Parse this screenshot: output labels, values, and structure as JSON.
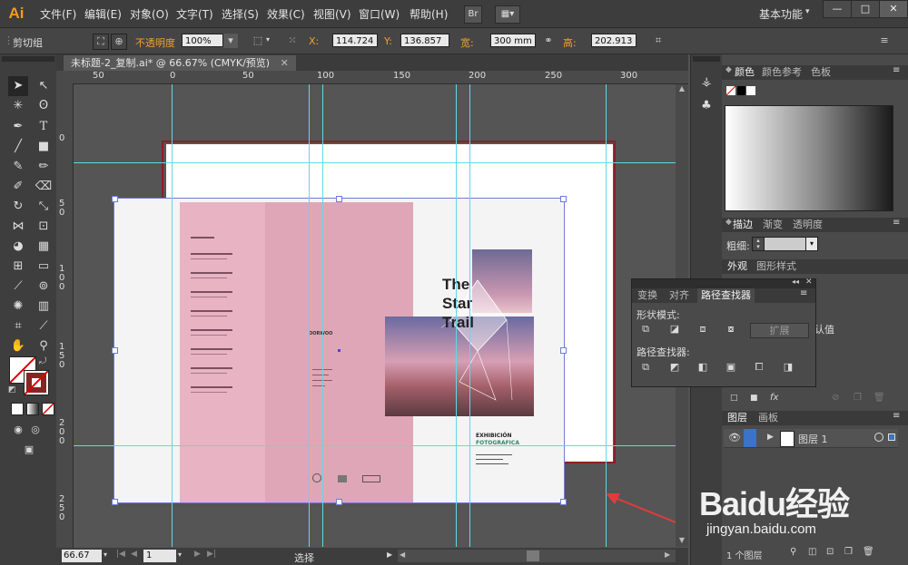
{
  "app": {
    "logo": "Ai",
    "menus": [
      "文件(F)",
      "编辑(E)",
      "对象(O)",
      "文字(T)",
      "选择(S)",
      "效果(C)",
      "视图(V)",
      "窗口(W)",
      "帮助(H)"
    ],
    "bridge_label": "Br",
    "workspace_label": "基本功能",
    "window_buttons": [
      "—",
      "□",
      "✕"
    ]
  },
  "control_bar": {
    "selection_label": "剪切组",
    "opacity_label": "不透明度",
    "opacity_value": "100%",
    "x_label": "X:",
    "x_value": "114.724",
    "y_label": "Y:",
    "y_value": "136.857",
    "width_label": "宽:",
    "width_value": "300 mm",
    "height_label": "高:",
    "height_value": "202.913"
  },
  "document": {
    "tab_title": "未标题-2_复制.ai* @ 66.67% (CMYK/预览)",
    "zoom": "66.67",
    "artboard_number": "1",
    "status_text": "选择"
  },
  "rulers": {
    "top_labels": [
      "50",
      "0",
      "50",
      "100",
      "150",
      "200",
      "250",
      "300"
    ],
    "left_labels": [
      "0",
      "50",
      "100",
      "150",
      "200",
      "250"
    ]
  },
  "artwork": {
    "title_line1": "The",
    "title_line2": "Star",
    "title_line3": "Trail",
    "brand": "OORWOO",
    "exhibition_line1": "EXHIBICIÓN",
    "exhibition_line2": "FOTOGRAFICA",
    "colors": {
      "pink": "#e8b3c3",
      "pink_dark": "#dfa6b8",
      "guide": "#5fd9e8",
      "bleed": "#8a2020",
      "selection": "#6f7bd6"
    }
  },
  "panels": {
    "color_tabs": [
      "颜色",
      "颜色参考",
      "色板"
    ],
    "stroke_tabs": [
      "描边",
      "渐变",
      "透明度"
    ],
    "stroke_weight_label": "粗细:",
    "appearance_tabs": [
      "外观",
      "图形样式"
    ],
    "appearance_default_text": "认值",
    "layers_tabs": [
      "图层",
      "画板"
    ],
    "layer_name": "图层 1",
    "layers_count": "1 个图层",
    "pathfinder_tabs": [
      "变换",
      "对齐",
      "路径查找器"
    ],
    "shape_modes_label": "形状模式:",
    "expand_button": "扩展",
    "pathfinders_label": "路径查找器:"
  },
  "watermark": {
    "brand": "Baidu经验",
    "url": "jingyan.baidu.com"
  }
}
